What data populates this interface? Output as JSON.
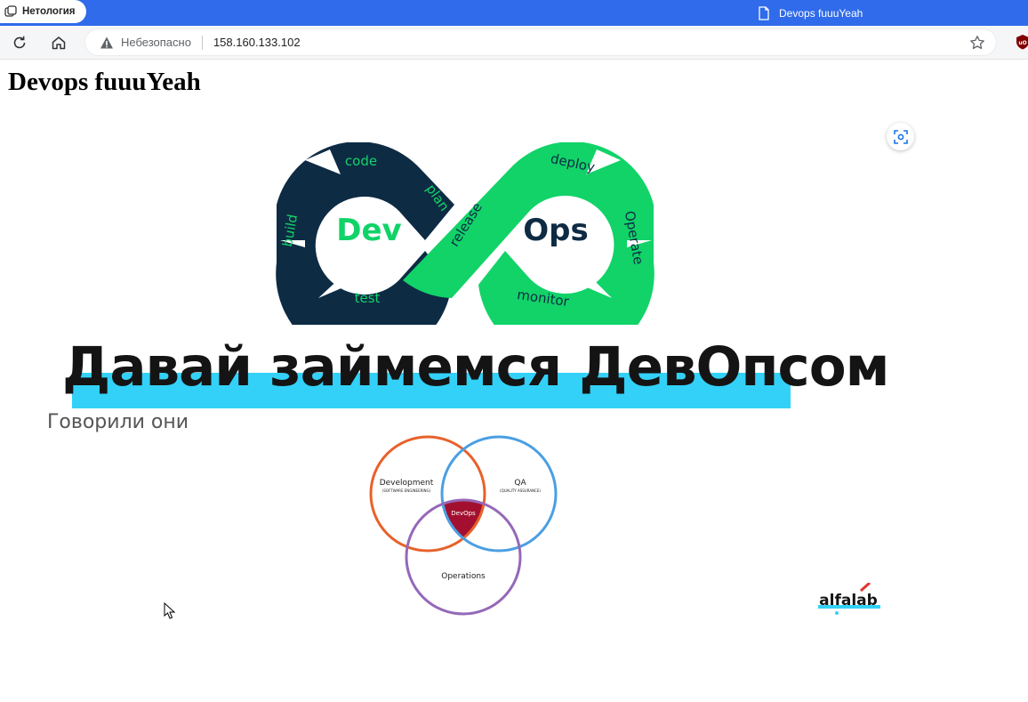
{
  "browser": {
    "pinned_tab": {
      "label": "Нетология"
    },
    "active_tab": {
      "title": "Devops fuuuYeah"
    },
    "address": {
      "security_text": "Небезопасно",
      "url": "158.160.133.102"
    }
  },
  "page": {
    "heading": "Devops fuuuYeah",
    "banner": {
      "loop": {
        "dev": "Dev",
        "ops": "Ops",
        "code": "code",
        "build": "build",
        "test": "test",
        "plan": "plan",
        "release": "release",
        "deploy": "deploy",
        "operate": "Operate",
        "monitor": "monitor"
      },
      "headline": "Давай займемся ДевОпсом",
      "subline": "Говорили они",
      "venn": {
        "development": "Development",
        "development_sub": "(SOFTWARE ENGINEERING)",
        "qa": "QA",
        "qa_sub": "(QUALITY ASSURANCE)",
        "devops": "DevOps",
        "operations": "Operations"
      },
      "brand": "alfalab"
    }
  },
  "colors": {
    "tabbar": "#2f6bea",
    "loop_dark": "#0e2b44",
    "loop_green": "#11d368",
    "highlight": "#33d1f7",
    "venn_dev": "#e8612b",
    "venn_qa": "#4a9fe3",
    "venn_ops": "#9568b8",
    "venn_center": "#a3102f"
  }
}
